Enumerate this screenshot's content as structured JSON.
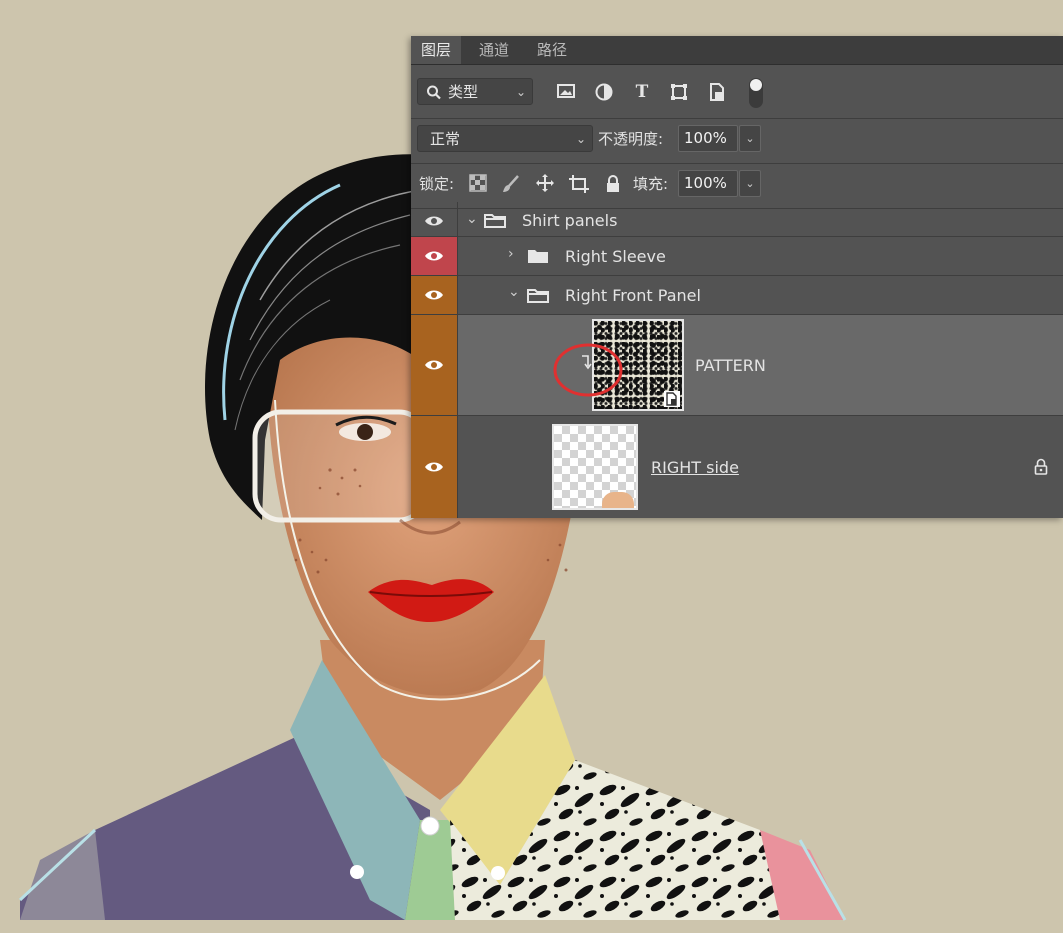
{
  "panel": {
    "tabs": [
      {
        "label": "图层",
        "active": true
      },
      {
        "label": "通道",
        "active": false
      },
      {
        "label": "路径",
        "active": false
      }
    ],
    "filter": {
      "label": "类型"
    },
    "blend_mode": "正常",
    "opacity_label": "不透明度:",
    "opacity_value": "100%",
    "lock_label": "锁定:",
    "fill_label": "填充:",
    "fill_value": "100%",
    "layers": [
      {
        "name": "Shirt panels",
        "type": "group",
        "expanded": true,
        "label_color": "none"
      },
      {
        "name": "Right Sleeve",
        "type": "group",
        "expanded": false,
        "label_color": "#c0454c"
      },
      {
        "name": "Right Front Panel",
        "type": "group",
        "expanded": true,
        "label_color": "#a8631f"
      },
      {
        "name": "PATTERN",
        "type": "smart-object",
        "clipping_mask": true,
        "selected": true,
        "label_color": "#a8631f"
      },
      {
        "name": "RIGHT side",
        "type": "pixel",
        "locked": true,
        "label_color": "#a8631f"
      }
    ]
  },
  "colors": {
    "background": "#cdc5ad",
    "panel_bg": "#535353",
    "tab_bar": "#3d3d3d",
    "selected_row": "#696969",
    "red_label": "#c0454c",
    "orange_label": "#a8631f",
    "highlight_circle": "#e03030"
  }
}
